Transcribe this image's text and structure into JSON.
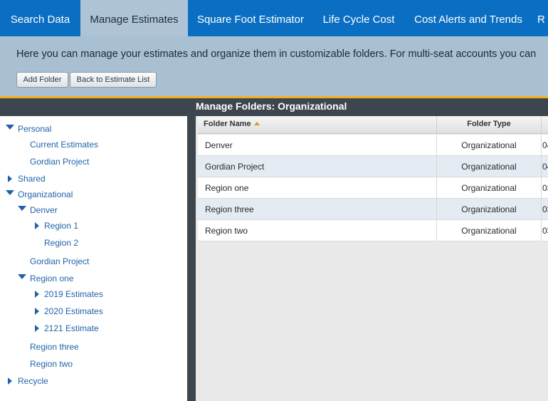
{
  "nav": {
    "tabs": [
      {
        "label": "Search Data"
      },
      {
        "label": "Manage Estimates"
      },
      {
        "label": "Square Foot Estimator"
      },
      {
        "label": "Life Cycle Cost"
      },
      {
        "label": "Cost Alerts and Trends"
      },
      {
        "label": "R"
      }
    ],
    "active_tab": "Manage Estimates"
  },
  "info": {
    "text": "Here you can manage your estimates and organize them in customizable folders. For multi-seat accounts you can",
    "add_folder_label": "Add Folder",
    "back_label": "Back to Estimate List"
  },
  "panel": {
    "title": "Manage Folders: Organizational"
  },
  "tree": {
    "personal": {
      "label": "Personal",
      "children": [
        "Current Estimates",
        "Gordian Project"
      ]
    },
    "shared": {
      "label": "Shared"
    },
    "organizational": {
      "label": "Organizational",
      "denver": {
        "label": "Denver",
        "children": [
          "Region 1",
          "Region 2"
        ]
      },
      "gordian": "Gordian Project",
      "region_one": {
        "label": "Region one",
        "children": [
          "2019 Estimates",
          "2020 Estimates",
          "2121 Estimate"
        ]
      },
      "region_three": "Region three",
      "region_two": "Region two"
    },
    "recycle": {
      "label": "Recycle"
    }
  },
  "grid": {
    "columns": [
      "Folder Name",
      "Folder Type"
    ],
    "rows": [
      {
        "name": "Denver",
        "type": "Organizational",
        "extra": "04"
      },
      {
        "name": "Gordian Project",
        "type": "Organizational",
        "extra": "04"
      },
      {
        "name": "Region one",
        "type": "Organizational",
        "extra": "03"
      },
      {
        "name": "Region three",
        "type": "Organizational",
        "extra": "03"
      },
      {
        "name": "Region two",
        "type": "Organizational",
        "extra": "03"
      }
    ]
  },
  "colors": {
    "nav_bg": "#0a6fc2",
    "active_tab_bg": "#aec4d6",
    "info_bg": "#a9c0d3",
    "accent_line": "#f2b01e",
    "dark_band": "#3d454e",
    "link": "#1f63a8",
    "alt_row": "#e4ebf3"
  }
}
